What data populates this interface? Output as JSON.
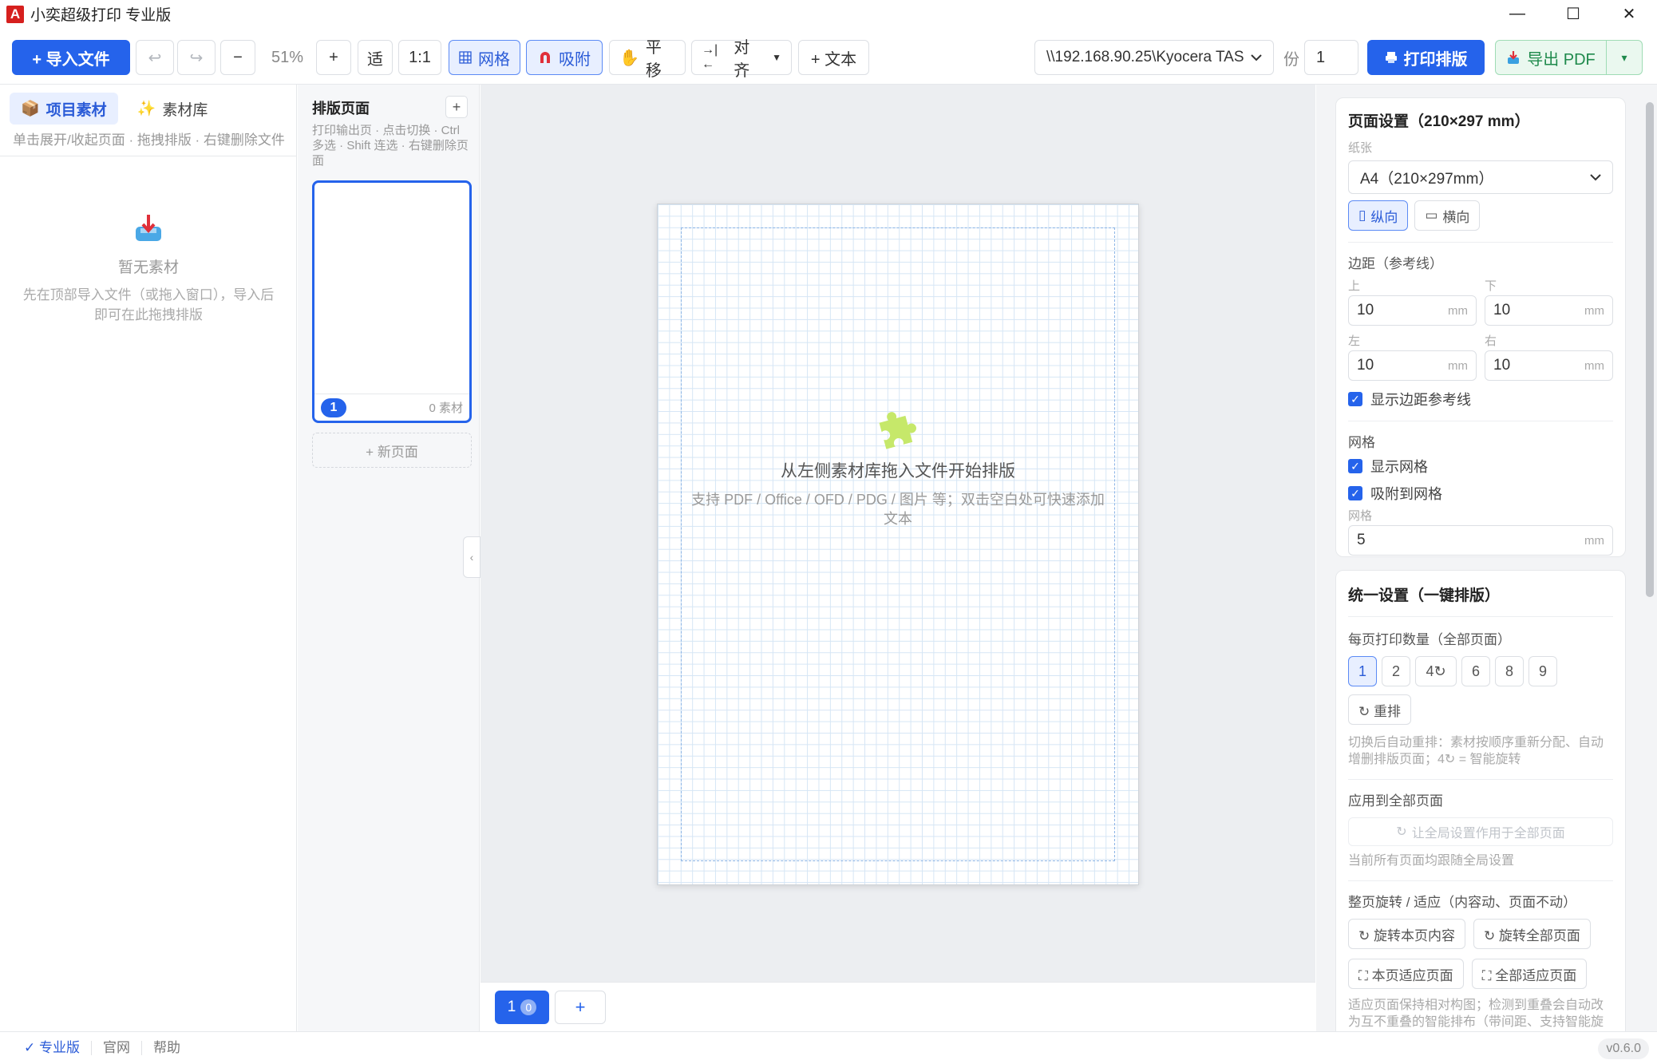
{
  "window": {
    "logo_letter": "A",
    "title": "小奕超级打印 专业版",
    "min_glyph": "—",
    "max_glyph": "☐",
    "close_glyph": "✕"
  },
  "toolbar": {
    "import_label": "+ 导入文件",
    "undo": "↩",
    "redo": "↪",
    "zoom_out": "−",
    "zoom_level": "51%",
    "zoom_in": "+",
    "fit_label": "适",
    "one_to_one": "1:1",
    "grid_label": "网格",
    "snap_label": "吸附",
    "pan_label": "平移",
    "align_label": "对齐",
    "text_label": "+ 文本",
    "printer": "\\\\192.168.90.25\\Kyocera TAS",
    "copies_label": "份",
    "copies_value": "1",
    "print_label": "打印排版",
    "export_label": "导出 PDF",
    "export_menu": "▾"
  },
  "left_panel": {
    "tab_project": "项目素材",
    "tab_library": "素材库",
    "hint": "单击展开/收起页面 · 拖拽排版 · 右键删除文件",
    "empty_title": "暂无素材",
    "empty_desc": "先在顶部导入文件（或拖入窗口），导入后即可在此拖拽排版"
  },
  "pages_panel": {
    "title": "排版页面",
    "add": "+",
    "hint": "打印输出页 · 点击切换 · Ctrl 多选 · Shift 连选 · 右键删除页面",
    "thumb_num": "1",
    "thumb_count": "0 素材",
    "new_page": "+ 新页面"
  },
  "canvas": {
    "collapse_glyph": "‹",
    "title": "从左侧素材库拖入文件开始排版",
    "desc": "支持 PDF / Office / OFD / PDG / 图片 等；双击空白处可快速添加文本"
  },
  "page_tabs": {
    "tab_num": "1",
    "tab_badge": "0",
    "add": "+"
  },
  "page_setup": {
    "title": "页面设置（210×297 mm）",
    "paper_label": "纸张",
    "paper_value": "A4（210×297mm）",
    "portrait": "纵向",
    "landscape": "横向",
    "margin_label": "边距（参考线）",
    "top_label": "上",
    "top_value": "10",
    "bottom_label": "下",
    "bottom_value": "10",
    "left_label": "左",
    "left_value": "10",
    "right_label": "右",
    "right_value": "10",
    "unit": "mm",
    "show_margin": "显示边距参考线",
    "grid_section": "网格",
    "show_grid": "显示网格",
    "snap_grid": "吸附到网格",
    "grid_size_label": "网格",
    "grid_size_value": "5"
  },
  "unified": {
    "title": "统一设置（一键排版）",
    "per_page_label": "每页打印数量（全部页面）",
    "counts": [
      "1",
      "2",
      "4↻",
      "6",
      "8",
      "9"
    ],
    "reflow": "↻ 重排",
    "reflow_hint": "切换后自动重排：素材按顺序重新分配、自动增删排版页面；4↻ = 智能旋转",
    "apply_label": "应用到全部页面",
    "apply_button": "让全局设置作用于全部页面",
    "apply_hint": "当前所有页面均跟随全局设置",
    "rotate_label": "整页旋转 / 适应（内容动、页面不动）",
    "rotate_this": "↻ 旋转本页内容",
    "rotate_all": "↻ 旋转全部页面",
    "fit_this": "⛶ 本页适应页面",
    "fit_all": "⛶ 全部适应页面",
    "fit_hint": "适应页面保持相对构图；检测到重叠会自动改为互不重叠的智能排布（带间距、支持智能旋转）"
  },
  "statusbar": {
    "pro": "✓ 专业版",
    "site": "官网",
    "help": "帮助",
    "version": "v0.6.0"
  },
  "colors": {
    "primary": "#2563eb",
    "brand_red": "#d6201e",
    "export_green": "#1f8a4c"
  }
}
